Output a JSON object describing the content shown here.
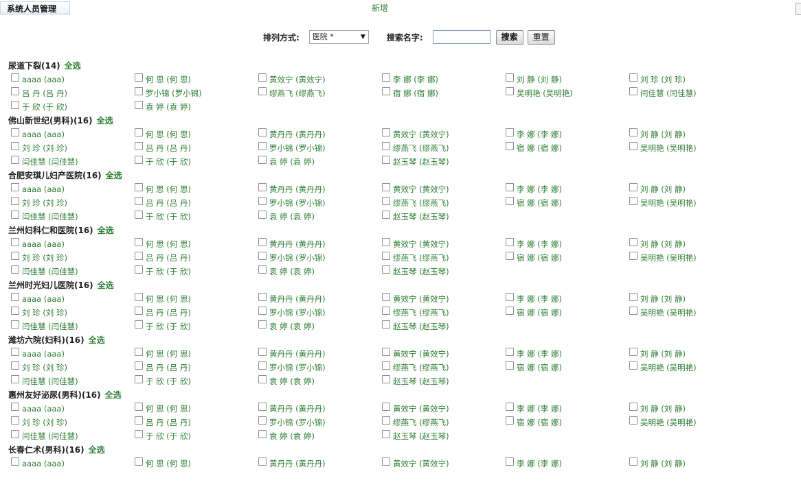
{
  "header": {
    "title": "系统人员管理",
    "add_label": "新增"
  },
  "toolbar": {
    "sort_label": "排列方式:",
    "sort_value": "医院 *",
    "search_label": "搜索名字:",
    "search_value": "",
    "search_button": "搜索",
    "reset_button": "重置"
  },
  "select_all_label": "全选",
  "groups": [
    {
      "name": "尿道下裂(14)",
      "members": [
        "aaaa (aaa)",
        "何 思 (何 思)",
        "黄效宁 (黄效宁)",
        "李 娜 (李 娜)",
        "刘 静 (刘 静)",
        "刘 珍 (刘 珍)",
        "吕 丹 (吕 丹)",
        "罗小锦 (罗小锦)",
        "缪燕飞 (缪燕飞)",
        "宿 娜 (宿 娜)",
        "吴明艳 (吴明艳)",
        "闫佳慧 (闫佳慧)",
        "于 欣 (于 欣)",
        "袁 婷 (袁 婷)"
      ]
    },
    {
      "name": "佛山新世纪(男科)(16)",
      "members": [
        "aaaa (aaa)",
        "何 思 (何 思)",
        "黄丹丹 (黄丹丹)",
        "黄效宁 (黄效宁)",
        "李 娜 (李 娜)",
        "刘 静 (刘 静)",
        "刘 珍 (刘 珍)",
        "吕 丹 (吕 丹)",
        "罗小锦 (罗小锦)",
        "缪燕飞 (缪燕飞)",
        "宿 娜 (宿 娜)",
        "吴明艳 (吴明艳)",
        "闫佳慧 (闫佳慧)",
        "于 欣 (于 欣)",
        "袁 婷 (袁 婷)",
        "赵玉琴 (赵玉琴)"
      ]
    },
    {
      "name": "合肥安琪儿妇产医院(16)",
      "members": [
        "aaaa (aaa)",
        "何 思 (何 思)",
        "黄丹丹 (黄丹丹)",
        "黄效宁 (黄效宁)",
        "李 娜 (李 娜)",
        "刘 静 (刘 静)",
        "刘 珍 (刘 珍)",
        "吕 丹 (吕 丹)",
        "罗小锦 (罗小锦)",
        "缪燕飞 (缪燕飞)",
        "宿 娜 (宿 娜)",
        "吴明艳 (吴明艳)",
        "闫佳慧 (闫佳慧)",
        "于 欣 (于 欣)",
        "袁 婷 (袁 婷)",
        "赵玉琴 (赵玉琴)"
      ]
    },
    {
      "name": "兰州妇科仁和医院(16)",
      "members": [
        "aaaa (aaa)",
        "何 思 (何 思)",
        "黄丹丹 (黄丹丹)",
        "黄效宁 (黄效宁)",
        "李 娜 (李 娜)",
        "刘 静 (刘 静)",
        "刘 珍 (刘 珍)",
        "吕 丹 (吕 丹)",
        "罗小锦 (罗小锦)",
        "缪燕飞 (缪燕飞)",
        "宿 娜 (宿 娜)",
        "吴明艳 (吴明艳)",
        "闫佳慧 (闫佳慧)",
        "于 欣 (于 欣)",
        "袁 婷 (袁 婷)",
        "赵玉琴 (赵玉琴)"
      ]
    },
    {
      "name": "兰州时光妇儿医院(16)",
      "members": [
        "aaaa (aaa)",
        "何 思 (何 思)",
        "黄丹丹 (黄丹丹)",
        "黄效宁 (黄效宁)",
        "李 娜 (李 娜)",
        "刘 静 (刘 静)",
        "刘 珍 (刘 珍)",
        "吕 丹 (吕 丹)",
        "罗小锦 (罗小锦)",
        "缪燕飞 (缪燕飞)",
        "宿 娜 (宿 娜)",
        "吴明艳 (吴明艳)",
        "闫佳慧 (闫佳慧)",
        "于 欣 (于 欣)",
        "袁 婷 (袁 婷)",
        "赵玉琴 (赵玉琴)"
      ]
    },
    {
      "name": "潍坊六院(妇科)(16)",
      "members": [
        "aaaa (aaa)",
        "何 思 (何 思)",
        "黄丹丹 (黄丹丹)",
        "黄效宁 (黄效宁)",
        "李 娜 (李 娜)",
        "刘 静 (刘 静)",
        "刘 珍 (刘 珍)",
        "吕 丹 (吕 丹)",
        "罗小锦 (罗小锦)",
        "缪燕飞 (缪燕飞)",
        "宿 娜 (宿 娜)",
        "吴明艳 (吴明艳)",
        "闫佳慧 (闫佳慧)",
        "于 欣 (于 欣)",
        "袁 婷 (袁 婷)",
        "赵玉琴 (赵玉琴)"
      ]
    },
    {
      "name": "惠州友好泌尿(男科)(16)",
      "members": [
        "aaaa (aaa)",
        "何 思 (何 思)",
        "黄丹丹 (黄丹丹)",
        "黄效宁 (黄效宁)",
        "李 娜 (李 娜)",
        "刘 静 (刘 静)",
        "刘 珍 (刘 珍)",
        "吕 丹 (吕 丹)",
        "罗小锦 (罗小锦)",
        "缪燕飞 (缪燕飞)",
        "宿 娜 (宿 娜)",
        "吴明艳 (吴明艳)",
        "闫佳慧 (闫佳慧)",
        "于 欣 (于 欣)",
        "袁 婷 (袁 婷)",
        "赵玉琴 (赵玉琴)"
      ]
    },
    {
      "name": "长春仁术(男科)(16)",
      "members": [
        "aaaa (aaa)",
        "何 思 (何 思)",
        "黄丹丹 (黄丹丹)",
        "黄效宁 (黄效宁)",
        "李 娜 (李 娜)",
        "刘 静 (刘 静)"
      ]
    }
  ]
}
